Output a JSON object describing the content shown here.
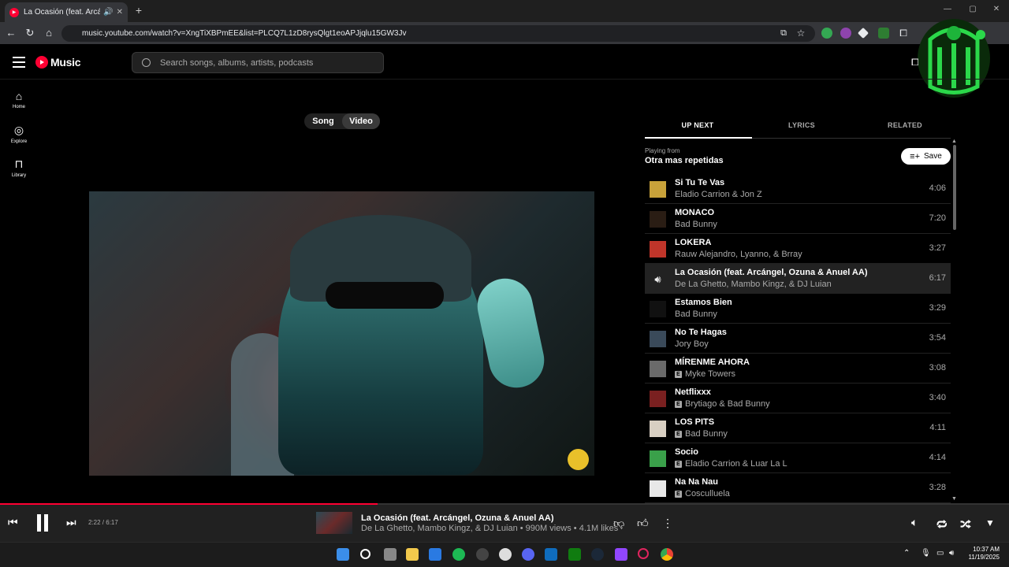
{
  "browser": {
    "tab_title": "La Ocasión (feat. Arcángel, Oz",
    "url": "music.youtube.com/watch?v=XngTiXBPmEE&list=PLCQ7L1zD8rysQlgt1eoAPJjqlu15GW3Jv"
  },
  "app": {
    "logo_text": "Music",
    "search_placeholder": "Search songs, albums, artists, podcasts"
  },
  "sidenav": [
    {
      "label": "Home",
      "icon": "home-icon"
    },
    {
      "label": "Explore",
      "icon": "compass-icon"
    },
    {
      "label": "Library",
      "icon": "bookmark-icon"
    }
  ],
  "toggle": {
    "song": "Song",
    "video": "Video",
    "active": "Video"
  },
  "tabs": {
    "up_next": "UP NEXT",
    "lyrics": "LYRICS",
    "related": "RELATED"
  },
  "queue_header": {
    "playing_from": "Playing from",
    "playlist": "Otra mas repetidas",
    "save": "Save"
  },
  "queue": [
    {
      "title": "Si Tu Te Vas",
      "artist": "Eladio Carrion & Jon Z",
      "duration": "4:06",
      "explicit": false,
      "thumb_color": "#c8a23a"
    },
    {
      "title": "MONACO",
      "artist": "Bad Bunny",
      "duration": "7:20",
      "explicit": false,
      "thumb_color": "#2a1d14"
    },
    {
      "title": "LOKERA",
      "artist": "Rauw Alejandro, Lyanno, & Brray",
      "duration": "3:27",
      "explicit": false,
      "thumb_color": "#c0352a"
    },
    {
      "title": "La Ocasión (feat. Arcángel, Ozuna & Anuel AA)",
      "artist": "De La Ghetto, Mambo Kingz, & DJ Luian",
      "duration": "6:17",
      "explicit": false,
      "thumb_color": "#222222",
      "playing": true
    },
    {
      "title": "Estamos Bien",
      "artist": "Bad Bunny",
      "duration": "3:29",
      "explicit": false,
      "thumb_color": "#111111"
    },
    {
      "title": "No Te Hagas",
      "artist": "Jory Boy",
      "duration": "3:54",
      "explicit": false,
      "thumb_color": "#3a4a5a"
    },
    {
      "title": "MÍRENME AHORA",
      "artist": "Myke Towers",
      "duration": "3:08",
      "explicit": true,
      "thumb_color": "#6a6a6a"
    },
    {
      "title": "Netflixxx",
      "artist": "Brytiago & Bad Bunny",
      "duration": "3:40",
      "explicit": true,
      "thumb_color": "#7a2020"
    },
    {
      "title": "LOS PITS",
      "artist": "Bad Bunny",
      "duration": "4:11",
      "explicit": true,
      "thumb_color": "#d8cfc2"
    },
    {
      "title": "Socio",
      "artist": "Eladio Carrion & Luar La L",
      "duration": "4:14",
      "explicit": true,
      "thumb_color": "#3aa04a"
    },
    {
      "title": "Na Na Nau",
      "artist": "Cosculluela",
      "duration": "3:28",
      "explicit": true,
      "thumb_color": "#e8e8e8"
    }
  ],
  "player": {
    "time": "2:22 / 6:17",
    "progress": 0.374,
    "title": "La Ocasión (feat. Arcángel, Ozuna & Anuel AA)",
    "subtitle": "De La Ghetto, Mambo Kingz, & DJ Luian • 990M views • 4.1M likes"
  },
  "taskbar": {
    "time": "10:37 AM",
    "date": "11/19/2025"
  },
  "colors": {
    "accent": "#ff0033",
    "bg": "#000000",
    "player_bg": "#212121"
  }
}
